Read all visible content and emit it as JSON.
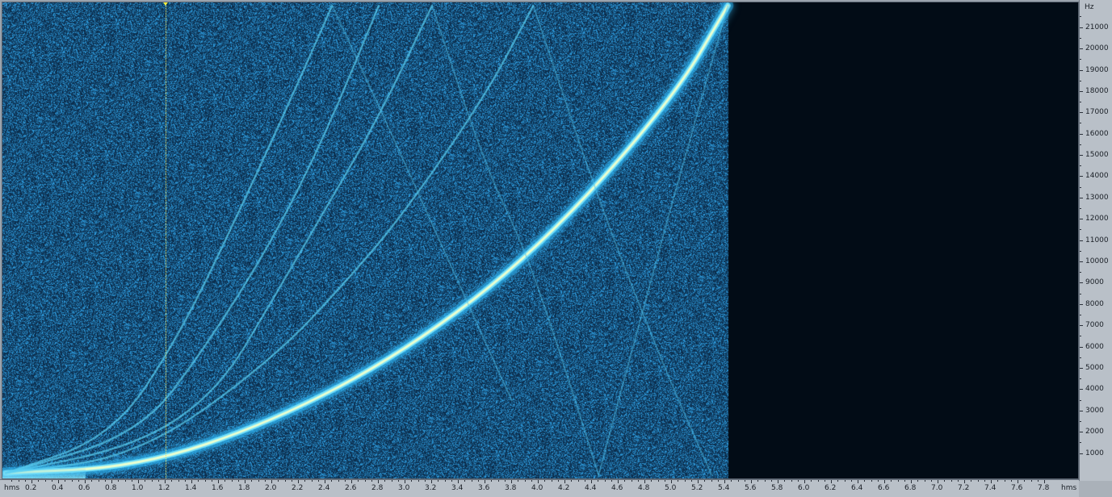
{
  "window": {
    "background": "#9aa3ad",
    "plot_background": "#020c16",
    "spectrum_color": "#2a8fd0",
    "peak_color": "#eaffd0",
    "playhead_color": "#f7ef3a"
  },
  "x_axis": {
    "unit_left": "hms",
    "unit_right": "hms",
    "ticks": [
      "0.2",
      "0.4",
      "0.6",
      "0.8",
      "1.0",
      "1.2",
      "1.4",
      "1.6",
      "1.8",
      "2.0",
      "2.2",
      "2.4",
      "2.6",
      "2.8",
      "3.0",
      "3.2",
      "3.4",
      "3.6",
      "3.8",
      "4.0",
      "4.2",
      "4.4",
      "4.6",
      "4.8",
      "5.0",
      "5.2",
      "5.4",
      "5.6",
      "5.8",
      "6.0",
      "6.2",
      "6.4",
      "6.6",
      "6.8",
      "7.0",
      "7.2",
      "7.4",
      "7.6",
      "7.8"
    ]
  },
  "y_axis": {
    "unit": "Hz",
    "ticks": [
      "21000",
      "20000",
      "19000",
      "18000",
      "17000",
      "16000",
      "15000",
      "14000",
      "13000",
      "12000",
      "11000",
      "10000",
      "9000",
      "8000",
      "7000",
      "6000",
      "5000",
      "4000",
      "3000",
      "2000",
      "1000"
    ]
  },
  "chart_data": {
    "type": "heatmap",
    "x_unit": "hms",
    "y_unit": "Hz",
    "xlim": [
      0,
      8.0
    ],
    "ylim": [
      0,
      22050
    ],
    "signal_end_time": 5.42,
    "playhead_time": 1.2,
    "sweeps": [
      {
        "kind": "fundamental",
        "points": [
          [
            0.0,
            100
          ],
          [
            1.0,
            400
          ],
          [
            2.0,
            2500
          ],
          [
            3.0,
            5800
          ],
          [
            4.0,
            10600
          ],
          [
            5.0,
            17600
          ],
          [
            5.42,
            22050
          ]
        ]
      },
      {
        "kind": "harmonic",
        "points": [
          [
            0.0,
            100
          ],
          [
            1.0,
            900
          ],
          [
            2.0,
            5400
          ],
          [
            2.6,
            9400
          ],
          [
            3.0,
            12400
          ],
          [
            3.6,
            17800
          ],
          [
            3.96,
            22050
          ]
        ]
      },
      {
        "kind": "harmonic",
        "points": [
          [
            0.0,
            100
          ],
          [
            1.0,
            1400
          ],
          [
            1.6,
            4000
          ],
          [
            2.0,
            8200
          ],
          [
            2.4,
            12500
          ],
          [
            2.8,
            16800
          ],
          [
            3.2,
            22050
          ]
        ]
      },
      {
        "kind": "harmonic",
        "points": [
          [
            0.0,
            100
          ],
          [
            1.0,
            1900
          ],
          [
            1.5,
            6000
          ],
          [
            2.0,
            11000
          ],
          [
            2.4,
            16000
          ],
          [
            2.8,
            22050
          ]
        ]
      },
      {
        "kind": "harmonic",
        "points": [
          [
            0.0,
            100
          ],
          [
            0.8,
            1800
          ],
          [
            1.3,
            6500
          ],
          [
            1.8,
            13000
          ],
          [
            2.2,
            18500
          ],
          [
            2.45,
            22050
          ]
        ]
      },
      {
        "kind": "aliased",
        "points": [
          [
            3.2,
            22050
          ],
          [
            3.6,
            14500
          ],
          [
            3.9,
            10600
          ],
          [
            4.2,
            5000
          ],
          [
            4.45,
            0
          ]
        ]
      },
      {
        "kind": "aliased",
        "points": [
          [
            4.45,
            0
          ],
          [
            4.8,
            8200
          ],
          [
            5.1,
            15000
          ],
          [
            5.42,
            22050
          ]
        ]
      },
      {
        "kind": "aliased",
        "points": [
          [
            3.96,
            22050
          ],
          [
            4.5,
            12000
          ],
          [
            5.0,
            4200
          ],
          [
            5.3,
            0
          ]
        ]
      },
      {
        "kind": "aliased",
        "points": [
          [
            2.45,
            22050
          ],
          [
            2.9,
            16000
          ],
          [
            3.4,
            9000
          ],
          [
            3.8,
            3500
          ]
        ]
      }
    ]
  }
}
